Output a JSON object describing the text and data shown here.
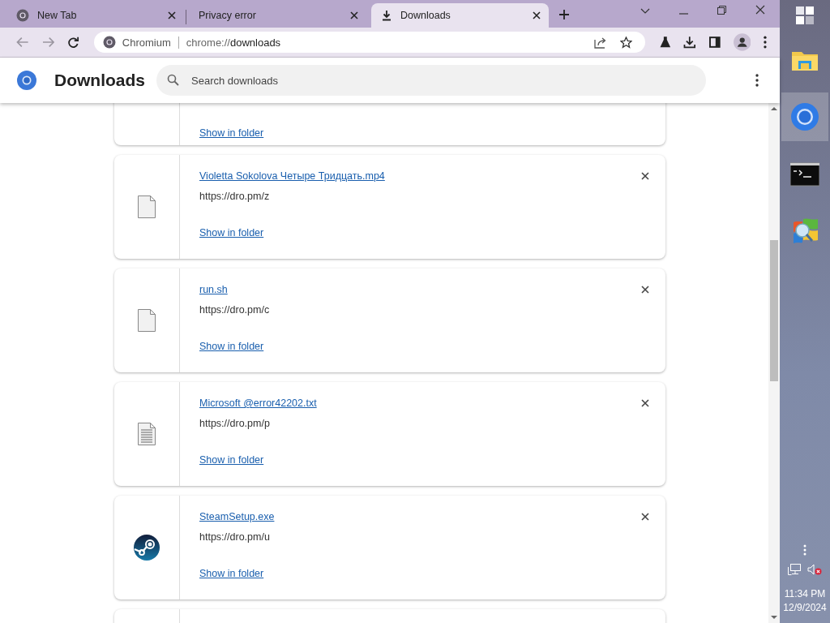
{
  "tabs": [
    {
      "title": "New Tab",
      "kind": "site",
      "selected": false
    },
    {
      "title": "Privacy error",
      "kind": "plain",
      "selected": false
    },
    {
      "title": "Downloads",
      "kind": "downloads",
      "selected": true
    }
  ],
  "omnibox": {
    "site": "Chromium",
    "url_prefix": "chrome://",
    "url_host": "downloads"
  },
  "page": {
    "title": "Downloads",
    "search_placeholder": "Search downloads"
  },
  "downloads": [
    {
      "kind": "partial",
      "action": "Show in folder"
    },
    {
      "kind": "blank",
      "name": "Violetta Sokolova Четыре Тридцать.mp4",
      "url": "https://dro.pm/z",
      "action": "Show in folder"
    },
    {
      "kind": "blank",
      "name": "run.sh",
      "url": "https://dro.pm/c",
      "action": "Show in folder"
    },
    {
      "kind": "text",
      "name": "Microsoft @error42202.txt",
      "url": "https://dro.pm/p",
      "action": "Show in folder"
    },
    {
      "kind": "steam",
      "name": "SteamSetup.exe",
      "url": "https://dro.pm/u",
      "action": "Show in folder"
    },
    {
      "kind": "edge"
    }
  ],
  "taskbar": {
    "apps": [
      {
        "kind": "explorer",
        "selected": false
      },
      {
        "kind": "chromium",
        "selected": true
      },
      {
        "kind": "terminal",
        "selected": false
      },
      {
        "kind": "xp",
        "selected": false
      }
    ],
    "time": "11:34 PM",
    "date": "12/9/2024"
  }
}
